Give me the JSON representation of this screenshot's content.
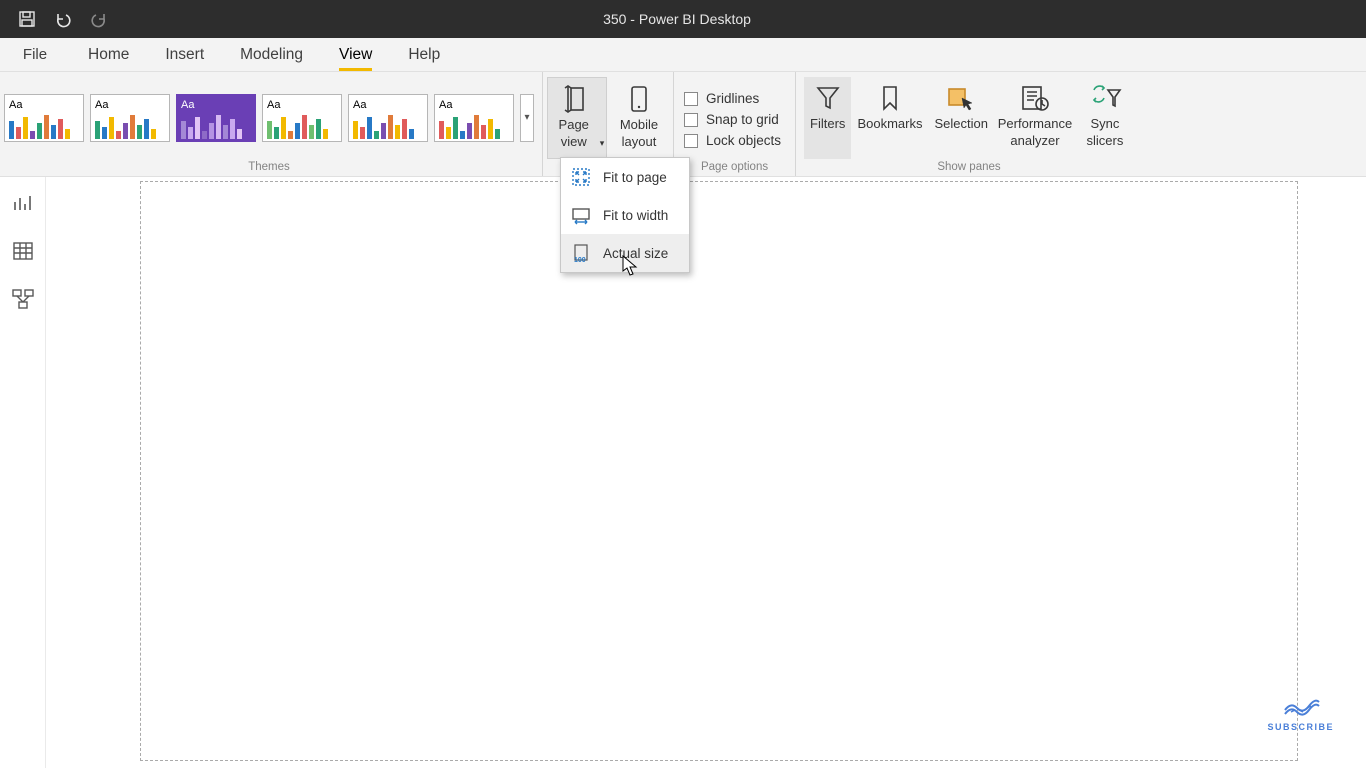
{
  "title": "350 - Power BI Desktop",
  "tabs": {
    "file": "File",
    "items": [
      "Home",
      "Insert",
      "Modeling",
      "View",
      "Help"
    ],
    "active_index": 3
  },
  "ribbon": {
    "themes": {
      "label": "Themes",
      "swatches": [
        {
          "aa": "Aa",
          "colors": [
            "#2779c6",
            "#e05b5b",
            "#f2b900",
            "#7a4db0",
            "#2aa276",
            "#e07b3a",
            "#2779c6",
            "#e05b5b",
            "#f2b900"
          ]
        },
        {
          "aa": "Aa",
          "colors": [
            "#2aa276",
            "#2779c6",
            "#f2b900",
            "#e05b5b",
            "#7a4db0",
            "#e07b3a",
            "#2aa276",
            "#2779c6",
            "#f2b900"
          ]
        },
        {
          "aa": "Aa",
          "colors": [
            "#a488d6",
            "#c9a8ef",
            "#e2c4f5",
            "#8e6bc7",
            "#b593e3",
            "#d6b8f2",
            "#a488d6",
            "#c9a8ef",
            "#e2c4f5"
          ],
          "selected": true
        },
        {
          "aa": "Aa",
          "colors": [
            "#6fbf6f",
            "#2aa276",
            "#f2b900",
            "#e07b3a",
            "#2779c6",
            "#e05b5b",
            "#6fbf6f",
            "#2aa276",
            "#f2b900"
          ]
        },
        {
          "aa": "Aa",
          "colors": [
            "#f2b900",
            "#e05b5b",
            "#2779c6",
            "#2aa276",
            "#7a4db0",
            "#e07b3a",
            "#f2b900",
            "#e05b5b",
            "#2779c6"
          ]
        },
        {
          "aa": "Aa",
          "colors": [
            "#e05b5b",
            "#f2b900",
            "#2aa276",
            "#2779c6",
            "#7a4db0",
            "#e07b3a",
            "#e05b5b",
            "#f2b900",
            "#2aa276"
          ]
        }
      ]
    },
    "scale": {
      "page_view": "Page view",
      "mobile_layout": "Mobile layout"
    },
    "page_options": {
      "label": "Page options",
      "gridlines": "Gridlines",
      "snap": "Snap to grid",
      "lock": "Lock objects"
    },
    "show_panes": {
      "label": "Show panes",
      "filters": "Filters",
      "bookmarks": "Bookmarks",
      "selection": "Selection",
      "performance": "Performance analyzer",
      "sync": "Sync slicers"
    }
  },
  "page_view_menu": {
    "fit_page": "Fit to page",
    "fit_width": "Fit to width",
    "actual_size": "Actual size"
  },
  "watermark": "SUBSCRIBE"
}
